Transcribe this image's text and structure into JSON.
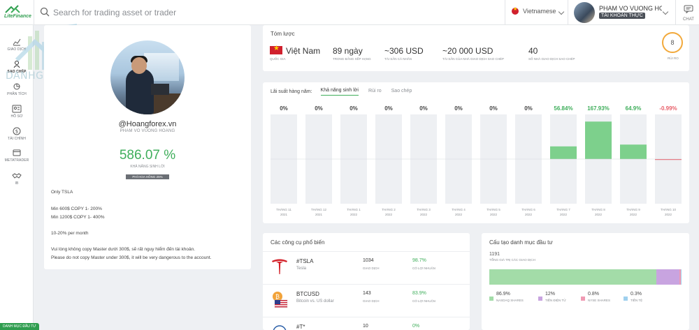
{
  "brand": {
    "logo_text": "LiteFinance"
  },
  "search": {
    "placeholder": "Search for trading asset or trader"
  },
  "language": {
    "label": "Vietnamese"
  },
  "user": {
    "name": "PHAM VO VUONG HOA...",
    "account_badge": "TÀI KHOẢN THỰC"
  },
  "chat": {
    "label": "CHAT"
  },
  "watermark": {
    "text": "DANHGIASAN.COM"
  },
  "sidebar": {
    "items": [
      {
        "label": "GIAO DỊCH",
        "icon": "chart-line-icon"
      },
      {
        "label": "SAO CHÉP",
        "icon": "copy-trade-icon"
      },
      {
        "label": "PHÂN TÍCH",
        "icon": "analysis-icon"
      },
      {
        "label": "HỒ SƠ",
        "icon": "profile-card-icon"
      },
      {
        "label": "TÀI CHÍNH",
        "icon": "dollar-icon"
      },
      {
        "label": "METATRADER",
        "icon": "terminal-icon"
      },
      {
        "label": "IB",
        "icon": "handshake-icon"
      }
    ],
    "bottom_button": "DANH MỤC ĐẦU TƯ"
  },
  "profile": {
    "handle": "@Hoangforex.vn",
    "full_name": "PHAM VO VUONG HOANG",
    "profitability": "586.07 %",
    "profitability_label": "KHẢ NĂNG SINH LỜI",
    "fee_badge": "PHÍ HOA HỒNG 25%",
    "description": [
      "Only TSLA",
      "Min 600$ COPY 1- 200%",
      "Min 1200$ COPY 1- 400%",
      "10-20% per month",
      "Vui lòng không copy Master dưới 300$, sẽ rất nguy hiểm đến tài khoản.",
      "Please do not copy Master under 300$, it will be very dangerous to the account."
    ]
  },
  "summary": {
    "title": "Tóm lược",
    "stats": [
      {
        "value": "Việt Nam",
        "label": "QUỐC GIA"
      },
      {
        "value": "89 ngày",
        "label": "TRONG BẢNG XẾP HẠNG"
      },
      {
        "value": "~306 USD",
        "label": "TÀI SẢN CÁ NHÂN"
      },
      {
        "value": "~20 000 USD",
        "label": "TÀI SẢN CỦA NHÀ GIAO DỊCH SAO CHÉP"
      },
      {
        "value": "40",
        "label": "SỐ NHÀ GIAO DỊCH SAO CHÉP"
      }
    ],
    "risk_value": "8",
    "risk_label": "RỦI RO"
  },
  "returns": {
    "title": "Lãi suất hàng năm:",
    "tabs": [
      "Khả năng sinh lời",
      "Rủi ro",
      "Sao chép"
    ],
    "active_tab": 0
  },
  "chart_data": {
    "type": "bar",
    "categories": [
      "THÁNG 11 2021",
      "THÁNG 12 2021",
      "THÁNG 1 2022",
      "THÁNG 2 2022",
      "THÁNG 3 2022",
      "THÁNG 4 2022",
      "THÁNG 5 2022",
      "THÁNG 6 2022",
      "THÁNG 7 2022",
      "THÁNG 8 2022",
      "THÁNG 9 2022",
      "THÁNG 10 2022"
    ],
    "month_labels": [
      "THÁNG 11",
      "THÁNG 12",
      "THÁNG 1",
      "THÁNG 2",
      "THÁNG 3",
      "THÁNG 4",
      "THÁNG 5",
      "THÁNG 6",
      "THÁNG 7",
      "THÁNG 8",
      "THÁNG 9",
      "THÁNG 10"
    ],
    "year_labels": [
      "2021",
      "2021",
      "2022",
      "2022",
      "2022",
      "2022",
      "2022",
      "2022",
      "2022",
      "2022",
      "2022",
      "2022"
    ],
    "values": [
      0,
      0,
      0,
      0,
      0,
      0,
      0,
      0,
      56.84,
      167.93,
      64.9,
      -0.99
    ],
    "value_labels": [
      "0%",
      "0%",
      "0%",
      "0%",
      "0%",
      "0%",
      "0%",
      "0%",
      "56.84%",
      "167.93%",
      "64.9%",
      "-0.99%"
    ],
    "ylim": [
      -200,
      200
    ],
    "positive_color": "#7dd08c",
    "negative_color": "#e8606a",
    "track_color": "#eef0f3"
  },
  "instruments": {
    "title": "Các công cụ phổ biến",
    "rows": [
      {
        "symbol": "#TSLA",
        "name": "Tesla",
        "count": "1034",
        "count_label": "GIAO DỊCH",
        "pct": "98.7%",
        "pct_label": "CÓ LỢI NHUẬN",
        "icon": "tesla-logo-icon"
      },
      {
        "symbol": "BTCUSD",
        "name": "Bitcoin vs. US dollar",
        "count": "143",
        "count_label": "GIAO DỊCH",
        "pct": "83.9%",
        "pct_label": "CÓ LỢI NHUẬN",
        "icon": "bitcoin-usd-icon"
      },
      {
        "symbol": "#T*",
        "name": "",
        "count": "10",
        "count_label": "",
        "pct": "0%",
        "pct_label": "",
        "icon": "instrument-icon"
      }
    ]
  },
  "portfolio": {
    "title": "Cấu tạo danh mục đầu tư",
    "total": "1191",
    "total_label": "TỔNG GIÁ TRỊ CÁC GIAO DỊCH",
    "segments": [
      {
        "pct": "86.9%",
        "share": 86.9,
        "label": "NASDAQ SHARES",
        "color": "#a3dca8"
      },
      {
        "pct": "12%",
        "share": 12,
        "label": "TIỀN ĐIỆN TỬ",
        "color": "#c8a4e0"
      },
      {
        "pct": "0.8%",
        "share": 0.8,
        "label": "NYSE SHARES",
        "color": "#f09ab3"
      },
      {
        "pct": "0.3%",
        "share": 0.3,
        "label": "TIỀN TỆ",
        "color": "#9fd0ee"
      }
    ]
  }
}
